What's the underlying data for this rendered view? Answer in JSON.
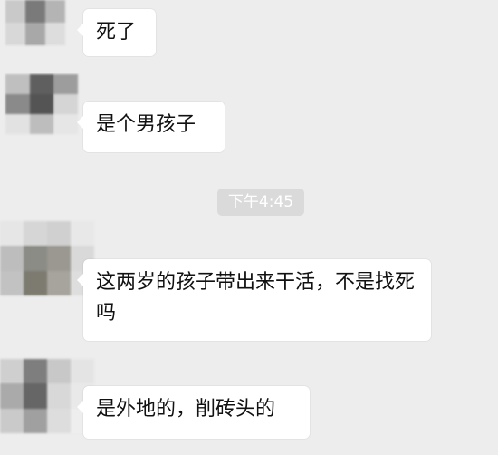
{
  "messages": [
    {
      "text": "死了"
    },
    {
      "text": "是个男孩子"
    },
    {
      "text": "这两岁的孩子带出来干活，不是找死吗"
    },
    {
      "text": "是外地的，削砖头的"
    }
  ],
  "timestamp": "下午4:45",
  "colors": {
    "background": "#ededed",
    "bubble": "#ffffff",
    "timestamp_pill": "#dadada"
  }
}
